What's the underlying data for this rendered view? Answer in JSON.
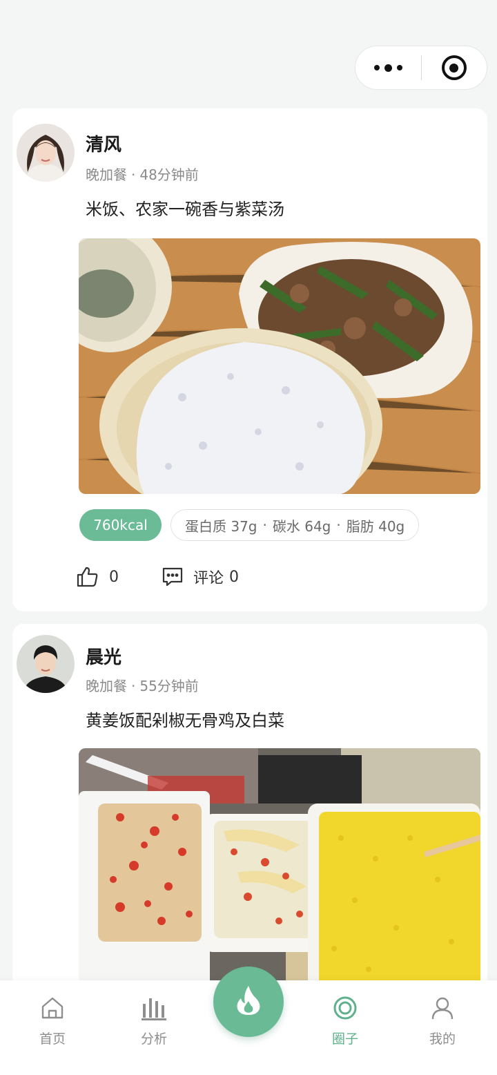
{
  "theme": {
    "accent": "#6cbb97",
    "background": "#f4f6f5"
  },
  "capsule": {
    "more_icon": "more-dots-icon",
    "close_icon": "target-circle-icon"
  },
  "posts": [
    {
      "username": "清风",
      "meal": "晚加餐",
      "time": "48分钟前",
      "description": "米饭、农家一碗香与紫菜汤",
      "photo": "rice, stir-fried pork with green peppers, seaweed soup",
      "kcal": "760kcal",
      "protein": "蛋白质 37g",
      "carbs": "碳水 64g",
      "fat": "脂肪 40g",
      "likes": "0",
      "comment_label": "评论",
      "comments": "0"
    },
    {
      "username": "晨光",
      "meal": "晚加餐",
      "time": "55分钟前",
      "description": "黄姜饭配剁椒无骨鸡及白菜",
      "photo": "turmeric rice, chopped chili boneless chicken, cabbage in takeaway boxes"
    }
  ],
  "separator": "·",
  "tabbar": {
    "items": [
      {
        "label": "首页",
        "icon": "home-icon"
      },
      {
        "label": "分析",
        "icon": "bar-chart-icon"
      },
      {
        "label": "圈子",
        "icon": "circle-icon",
        "active": true
      },
      {
        "label": "我的",
        "icon": "user-icon"
      }
    ],
    "center_icon": "flame-icon"
  }
}
